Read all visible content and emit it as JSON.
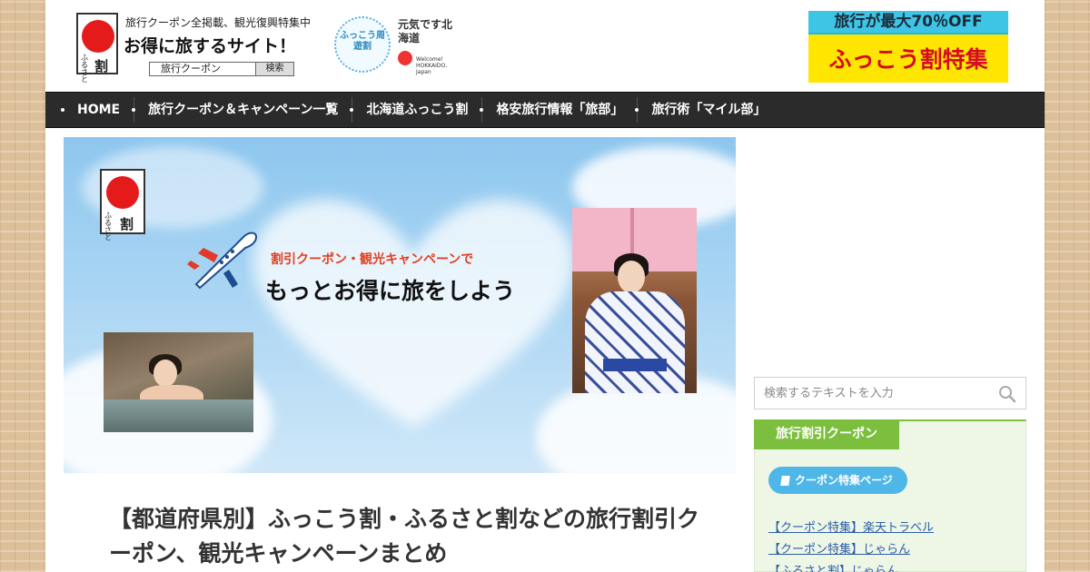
{
  "header": {
    "logo": {
      "mark_furusato": "ふるさと",
      "mark_wari": "割",
      "tagline": "旅行クーポン全掲載、観光復興特集中",
      "title": "お得に旅するサイト！",
      "search_label": "旅行クーポン",
      "search_button": "検索"
    },
    "fukko_badge": "ふっこう周遊割",
    "genki": "元気です北海道",
    "genki_small": "Welcome! HOKKAIDO, Japan",
    "ad_top": "旅行が最大70％OFF",
    "ad_bottom": "ふっこう割特集"
  },
  "nav": {
    "items": [
      {
        "label": "HOME"
      },
      {
        "label": "旅行クーポン＆キャンペーン一覧"
      },
      {
        "label": "北海道ふっこう割"
      },
      {
        "label": "格安旅行情報「旅部」"
      },
      {
        "label": "旅行術「マイル部」"
      }
    ]
  },
  "hero": {
    "logo_furusato": "ふるさと",
    "logo_wari": "割",
    "subtitle": "割引クーポン・観光キャンペーンで",
    "main": "もっとお得に旅をしよう"
  },
  "article": {
    "title": "【都道府県別】ふっこう割・ふるさと割などの旅行割引クーポン、観光キャンペーンまとめ"
  },
  "sidebar": {
    "search_placeholder": "検索するテキストを入力",
    "widget_title": "旅行割引クーポン",
    "widget_button": "クーポン特集ページ",
    "links": [
      {
        "label": "【クーポン特集】楽天トラベル"
      },
      {
        "label": "【クーポン特集】じゃらん"
      },
      {
        "label": "【ふるさと割】じゃらん"
      }
    ]
  },
  "colors": {
    "nav_bg": "#2b2b2b",
    "accent_green": "#7cbf3f",
    "accent_blue": "#4fb7e8",
    "link": "#2c5ea8",
    "logo_red": "#e51b1b"
  },
  "icons": [
    "search-icon",
    "book-icon",
    "airplane-icon"
  ]
}
